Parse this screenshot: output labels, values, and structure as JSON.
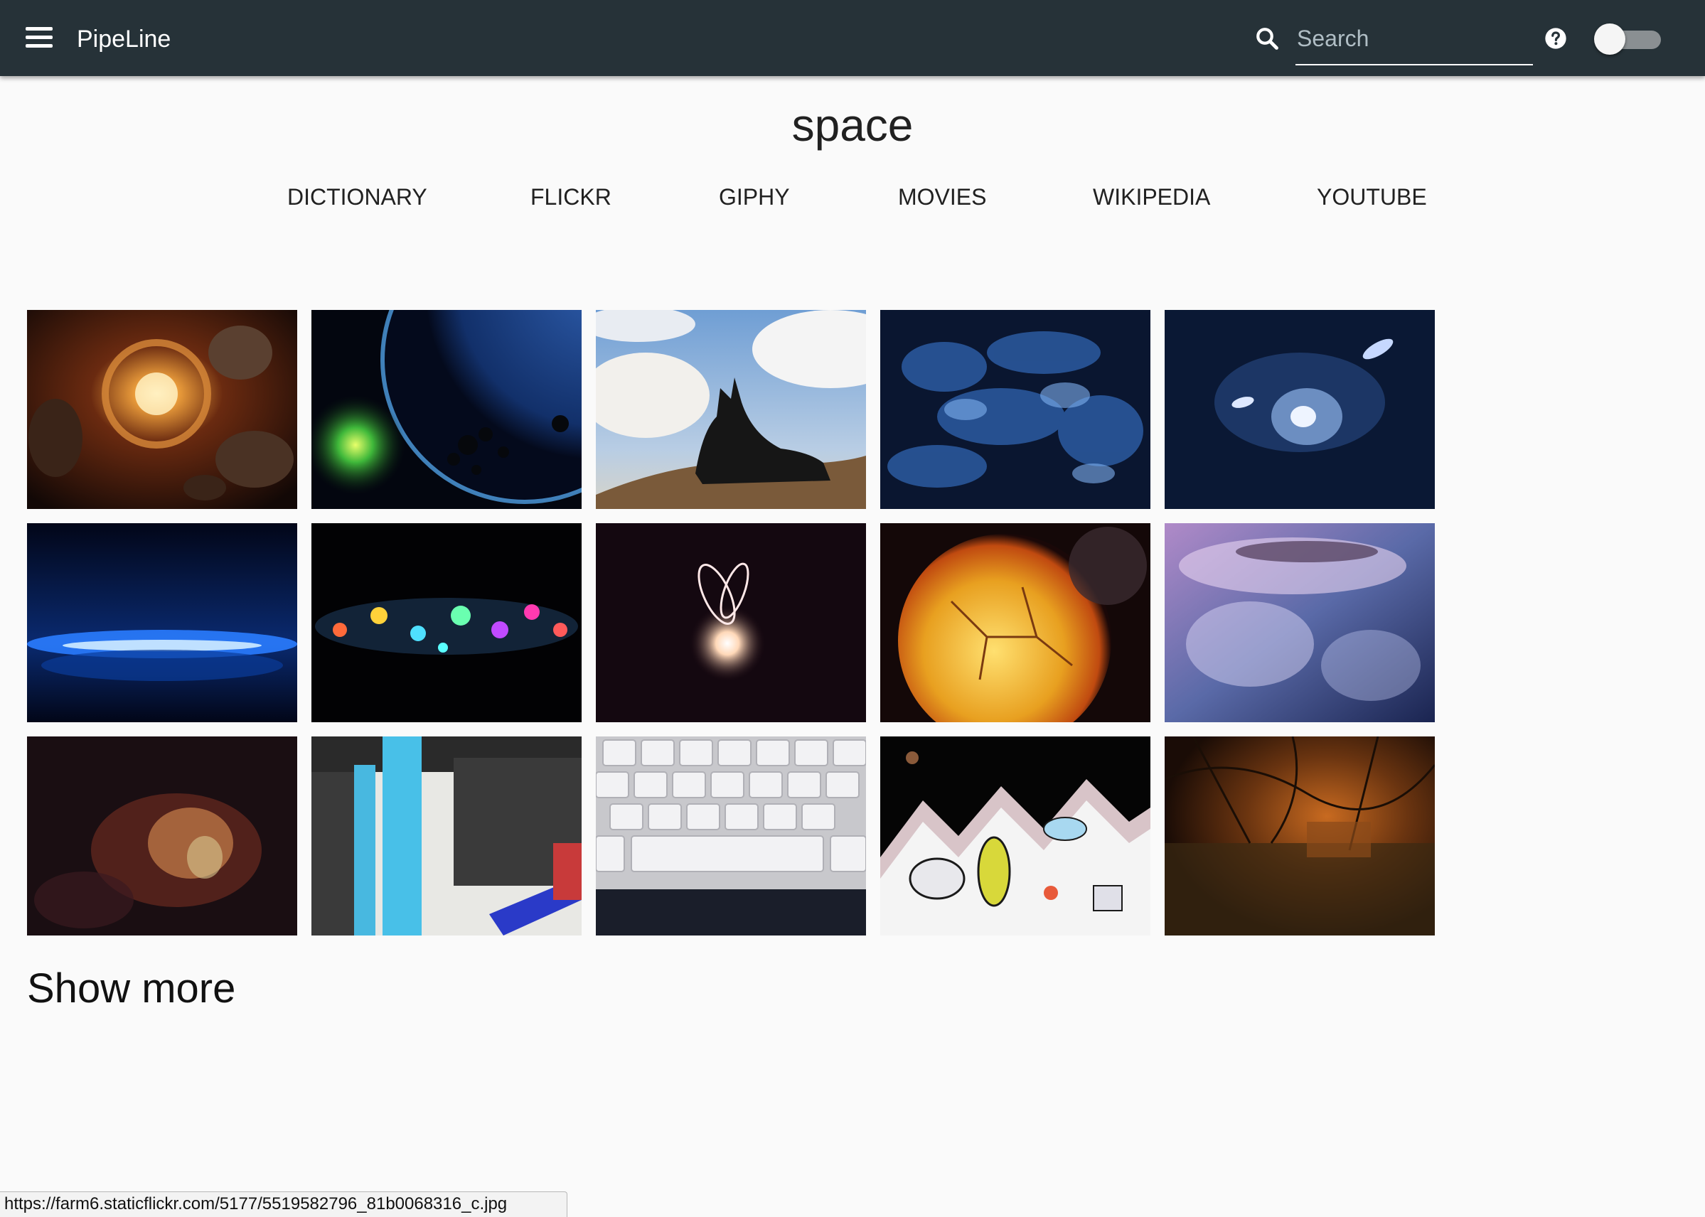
{
  "app": {
    "title": "PipeLine"
  },
  "search": {
    "placeholder": "Search",
    "value": ""
  },
  "query": {
    "heading": "space"
  },
  "tabs": [
    {
      "label": "DICTIONARY"
    },
    {
      "label": "FLICKR"
    },
    {
      "label": "GIPHY"
    },
    {
      "label": "MOVIES"
    },
    {
      "label": "WIKIPEDIA"
    },
    {
      "label": "YOUTUBE"
    }
  ],
  "results": {
    "show_more_label": "Show more"
  },
  "status_bar": {
    "url": "https://farm6.staticflickr.com/5177/5519582796_81b0068316_c.jpg"
  },
  "colors": {
    "appbar": "#263238",
    "background": "#fafafa",
    "text": "#212121",
    "toggle_track": "#8a8f92",
    "toggle_knob": "#f5f5f5"
  },
  "icons": {
    "menu": "menu-icon",
    "search": "search-icon",
    "help": "help-circle-icon",
    "toggle": "toggle-switch-off"
  }
}
